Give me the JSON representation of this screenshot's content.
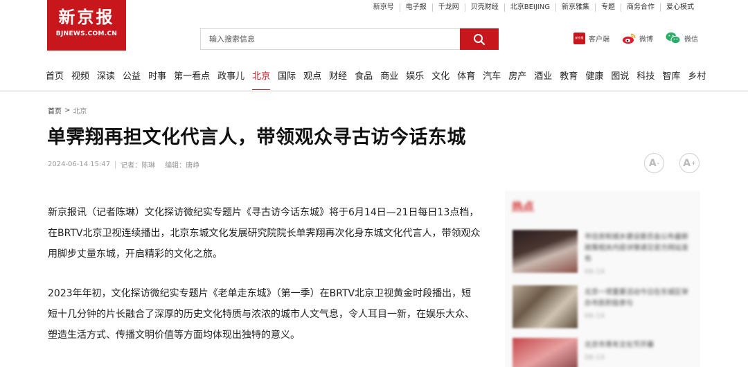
{
  "top_links": [
    "新京号",
    "电子报",
    "千龙网",
    "贝壳财经",
    "北京BEIJING",
    "新京雅集",
    "专题",
    "商务合作",
    "爱心模式"
  ],
  "logo": {
    "name_cn": "新京报",
    "domain": "BJNEWS.COM.CN"
  },
  "search": {
    "placeholder": "输入搜索信息"
  },
  "apps": {
    "client_label": "客户端",
    "client_icon_text": "新京报",
    "weibo_label": "微博",
    "wechat_label": "微信"
  },
  "nav": {
    "items": [
      "首页",
      "视频",
      "深读",
      "公益",
      "时事",
      "第一看点",
      "政事儿",
      "北京",
      "国际",
      "观点",
      "财经",
      "食品",
      "商业",
      "娱乐",
      "文化",
      "体育",
      "汽车",
      "房产",
      "酒业",
      "教育",
      "健康",
      "图说",
      "科技",
      "智库",
      "乡村"
    ],
    "active": "北京"
  },
  "breadcrumb": {
    "home": "首页",
    "separator": ">",
    "current": "北京"
  },
  "article": {
    "title": "单霁翔再担文化代言人，带领观众寻古访今话东城",
    "datetime": "2024-06-14 15:47",
    "reporter": "记者：陈琳",
    "editor": "编辑：唐峥",
    "paragraphs": [
      "新京报讯（记者陈琳）文化探访微纪实专题片《寻古访今话东城》将于6月14日—21日每日13点档，在BRTV北京卫视连续播出，北京东城文化发展研究院院长单霁翔再次化身东城文化代言人，带领观众用脚步丈量东城，开启精彩的文化之旅。",
      "2023年年初，文化探访微纪实专题片《老单走东城》（第一季）在BRTV北京卫视黄金时段播出，短短十几分钟的片长融合了深厚的历史文化特质与浓浓的城市人文气息，令人耳目一新，在娱乐大众、塑造生活方式、传播文明价值等方面均体现出独特的意义。"
    ]
  },
  "font_buttons": {
    "decrease": "A",
    "decrease_sup": "-",
    "increase": "A",
    "increase_sup": "+"
  },
  "sidebar": {
    "title": "热点",
    "items": [
      {
        "text": "市住房和城乡建设委员会公布最新政策相关内容详情请见官方网站发布",
        "date": "06-14",
        "thumb_color": "#3a2a28"
      },
      {
        "text": "北京一项重要活动今日在东城区举办市民积极参与",
        "date": "06-14",
        "thumb_color": "#8a7460"
      },
      {
        "text": "北京市青年文化节开幕",
        "date": "06-14",
        "thumb_color": "#7a3a3a"
      }
    ]
  },
  "colors": {
    "brand_red": "#c8161d",
    "weibo": "#e6162d",
    "wechat": "#2aae67"
  }
}
